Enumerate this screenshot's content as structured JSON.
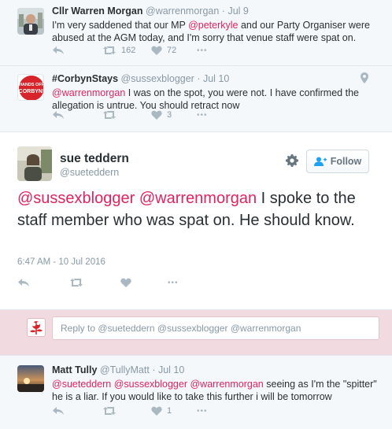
{
  "tweets": [
    {
      "name": "Cllr Warren Morgan",
      "handle": "@warrenmorgan",
      "dot": "·",
      "time": "Jul 9",
      "text_parts": {
        "a": "I'm very saddened that our MP ",
        "mention": "@peterkyle",
        "b": " and our Party Organiser were abused at the AGM today, and I'm sorry that venue staff were spat on."
      },
      "retweets": "162",
      "likes": "72",
      "more": "•••",
      "avatar_icon": "profile-photo-icon"
    },
    {
      "name": "#CorbynStays",
      "handle": "@sussexblogger",
      "dot": "·",
      "time": "Jul 10",
      "text_parts": {
        "mention": "@warrenmorgan",
        "b": " I was on the spot, you were not. I have confirmed the allegation is untrue. You should retract now"
      },
      "retweets": "",
      "likes": "3",
      "more": "•••",
      "avatar_badge": {
        "line1": "HANDS OFF",
        "line2": "CORBYN!"
      },
      "geo_icon": "location-pin-icon"
    }
  ],
  "main_tweet": {
    "name": "sue teddern",
    "handle": "@sueteddern",
    "follow_label": "Follow",
    "text_parts": {
      "mention1": "@sussexblogger",
      "space": " ",
      "mention2": "@warrenmorgan",
      "b": " I spoke to the staff member who was spat on. He should know."
    },
    "timestamp": "6:47 AM - 10 Jul 2016",
    "more": "•••"
  },
  "reply": {
    "placeholder": "Reply to @sueteddern @sussexblogger @warrenmorgan"
  },
  "reply_tweet": {
    "name": "Matt Tully",
    "handle": "@TullyMatt",
    "dot": "·",
    "time": "Jul 10",
    "text_parts": {
      "mentions": "@sueteddern @sussexblogger @warrenmorgan",
      "b": " seeing as I'm the \"spitter\" he is a liar. If you would like to take this further i will be tomorrow"
    },
    "likes": "1",
    "more": "•••"
  },
  "colors": {
    "mention": "#e0245e",
    "muted": "#8899a6",
    "reply_bar": "#f2dbe0",
    "badge_red": "#d8232a"
  }
}
